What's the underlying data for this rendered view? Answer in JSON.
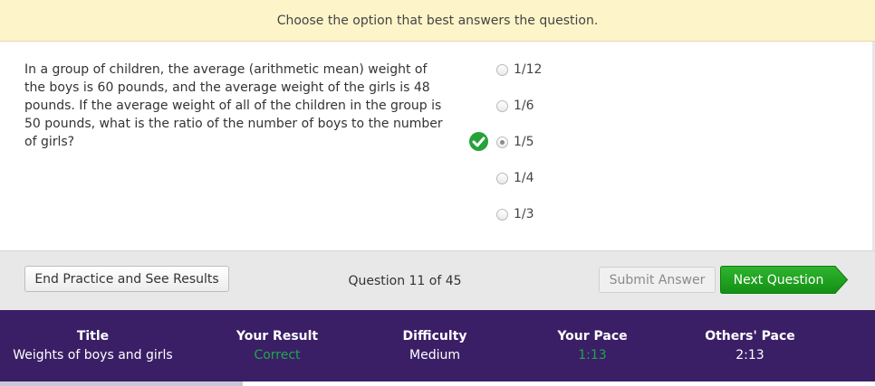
{
  "instruction": "Choose the option that best answers the question.",
  "question": "In a group of children, the average (arithmetic mean) weight of the boys is 60 pounds, and the average weight of the girls is 48 pounds. If the average weight of all of the children in the group is 50 pounds, what is the ratio of the number of boys to the number of girls?",
  "options": [
    {
      "label": "1/12",
      "selected": false
    },
    {
      "label": "1/6",
      "selected": false
    },
    {
      "label": "1/5",
      "selected": true
    },
    {
      "label": "1/4",
      "selected": false
    },
    {
      "label": "1/3",
      "selected": false
    }
  ],
  "toolbar": {
    "end_label": "End Practice and See Results",
    "counter": "Question 11 of 45",
    "submit_label": "Submit Answer",
    "next_label": "Next Question"
  },
  "stats": {
    "title_head": "Title",
    "title_val": "Weights of boys and girls",
    "result_head": "Your Result",
    "result_val": "Correct",
    "difficulty_head": "Difficulty",
    "difficulty_val": "Medium",
    "pace_head": "Your Pace",
    "pace_val": "1:13",
    "others_head": "Others' Pace",
    "others_val": "2:13"
  },
  "colors": {
    "instruction_bg": "#fdf5c9",
    "stats_bg": "#3a1f66",
    "accent_green": "#1fa64a",
    "next_button": "#22a322"
  },
  "icons": {
    "correct": "check-circle-icon",
    "next": "arrow-button-shape"
  }
}
